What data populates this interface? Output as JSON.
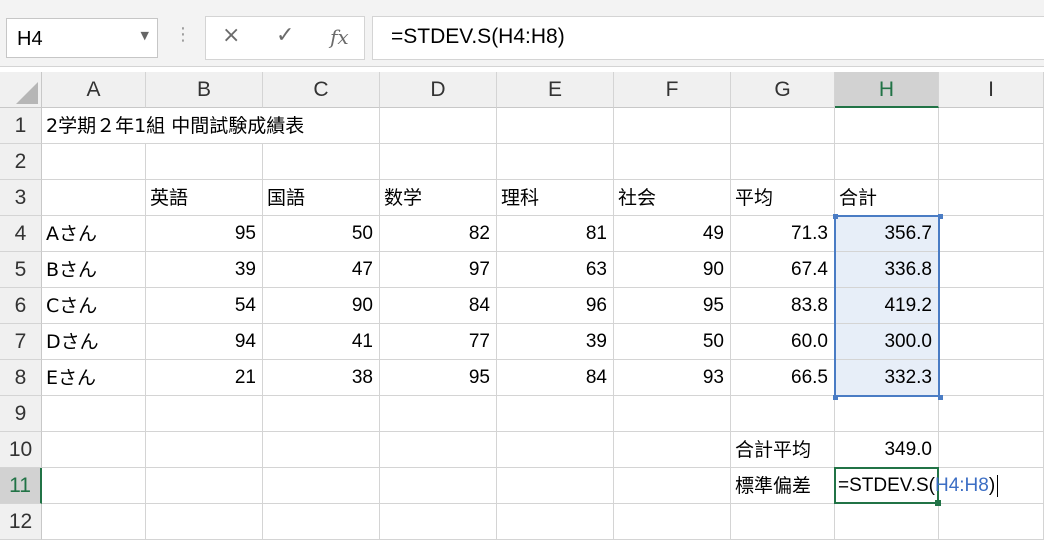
{
  "name_box": {
    "value": "H4"
  },
  "formula_bar": {
    "cancel_icon": "×",
    "enter_icon": "✓",
    "function_icon": "fx",
    "content": "=STDEV.S(H4:H8)"
  },
  "columns": [
    "A",
    "B",
    "C",
    "D",
    "E",
    "F",
    "G",
    "H",
    "I"
  ],
  "rows": [
    "1",
    "2",
    "3",
    "4",
    "5",
    "6",
    "7",
    "8",
    "9",
    "10",
    "11",
    "12"
  ],
  "selected_column": "H",
  "selected_row": "11",
  "title": "2学期２年1組 中間試験成績表",
  "headers": {
    "english": "英語",
    "japanese": "国語",
    "math": "数学",
    "science": "理科",
    "social": "社会",
    "average": "平均",
    "total": "合計"
  },
  "students": [
    {
      "name": "Aさん",
      "english": "95",
      "japanese": "50",
      "math": "82",
      "science": "81",
      "social": "49",
      "average": "71.3",
      "total": "356.7"
    },
    {
      "name": "Bさん",
      "english": "39",
      "japanese": "47",
      "math": "97",
      "science": "63",
      "social": "90",
      "average": "67.4",
      "total": "336.8"
    },
    {
      "name": "Cさん",
      "english": "54",
      "japanese": "90",
      "math": "84",
      "science": "96",
      "social": "95",
      "average": "83.8",
      "total": "419.2"
    },
    {
      "name": "Dさん",
      "english": "94",
      "japanese": "41",
      "math": "77",
      "science": "39",
      "social": "50",
      "average": "60.0",
      "total": "300.0"
    },
    {
      "name": "Eさん",
      "english": "21",
      "japanese": "38",
      "math": "95",
      "science": "84",
      "social": "93",
      "average": "66.5",
      "total": "332.3"
    }
  ],
  "summary": {
    "total_average_label": "合計平均",
    "total_average_value": "349.0",
    "stdev_label": "標準偏差",
    "editing_formula_prefix": "=STDEV.S(",
    "editing_formula_ref": "H4:H8",
    "editing_formula_suffix": ")"
  },
  "colors": {
    "selection_border": "#4a7cc4",
    "active_green": "#217346",
    "selection_fill": "#e7eef8"
  }
}
